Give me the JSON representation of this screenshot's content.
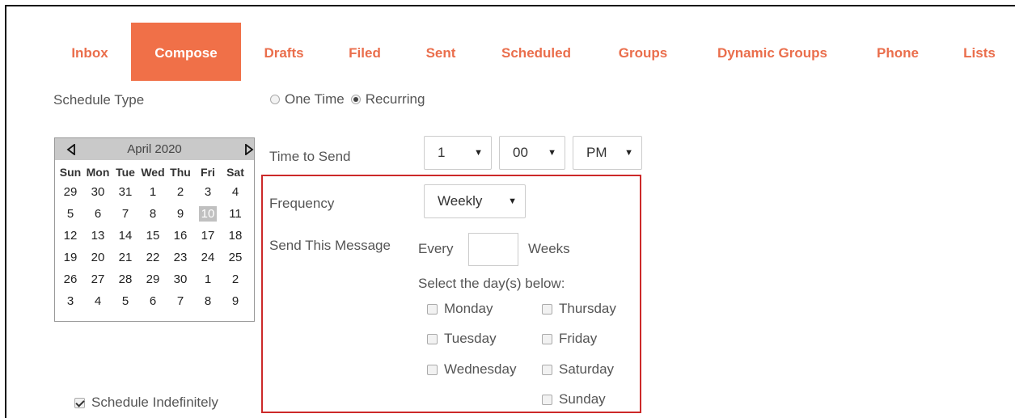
{
  "nav": {
    "tabs": [
      {
        "label": "Inbox",
        "active": false
      },
      {
        "label": "Compose",
        "active": true
      },
      {
        "label": "Drafts",
        "active": false
      },
      {
        "label": "Filed",
        "active": false
      },
      {
        "label": "Sent",
        "active": false
      },
      {
        "label": "Scheduled",
        "active": false
      },
      {
        "label": "Groups",
        "active": false
      },
      {
        "label": "Dynamic Groups",
        "active": false
      },
      {
        "label": "Phone",
        "active": false
      },
      {
        "label": "Lists",
        "active": false
      }
    ]
  },
  "schedule": {
    "type_label": "Schedule Type",
    "options": [
      {
        "label": "One Time",
        "checked": false
      },
      {
        "label": "Recurring",
        "checked": true
      }
    ]
  },
  "calendar": {
    "month_label": "April 2020",
    "weekdays": [
      "Sun",
      "Mon",
      "Tue",
      "Wed",
      "Thu",
      "Fri",
      "Sat"
    ],
    "weeks": [
      [
        "29",
        "30",
        "31",
        "1",
        "2",
        "3",
        "4"
      ],
      [
        "5",
        "6",
        "7",
        "8",
        "9",
        "10",
        "11"
      ],
      [
        "12",
        "13",
        "14",
        "15",
        "16",
        "17",
        "18"
      ],
      [
        "19",
        "20",
        "21",
        "22",
        "23",
        "24",
        "25"
      ],
      [
        "26",
        "27",
        "28",
        "29",
        "30",
        "1",
        "2"
      ],
      [
        "3",
        "4",
        "5",
        "6",
        "7",
        "8",
        "9"
      ]
    ],
    "selected_day": "10"
  },
  "time": {
    "label": "Time to Send",
    "hour": "1",
    "minute": "00",
    "ampm": "PM"
  },
  "frequency": {
    "label": "Frequency",
    "value": "Weekly",
    "send_label": "Send This Message",
    "every_label": "Every",
    "every_value": "",
    "unit_label": "Weeks",
    "days_prompt": "Select the day(s) below:",
    "days": [
      {
        "label": "Monday",
        "checked": false
      },
      {
        "label": "Thursday",
        "checked": false
      },
      {
        "label": "Tuesday",
        "checked": false
      },
      {
        "label": "Friday",
        "checked": false
      },
      {
        "label": "Wednesday",
        "checked": false
      },
      {
        "label": "Saturday",
        "checked": false
      },
      {
        "label": "Sunday",
        "checked": false
      }
    ]
  },
  "indefinite": {
    "label": "Schedule Indefinitely",
    "checked": true
  },
  "colors": {
    "accent": "#f07048",
    "tab_text": "#ea6e4c",
    "highlight_border": "#cc2929"
  }
}
